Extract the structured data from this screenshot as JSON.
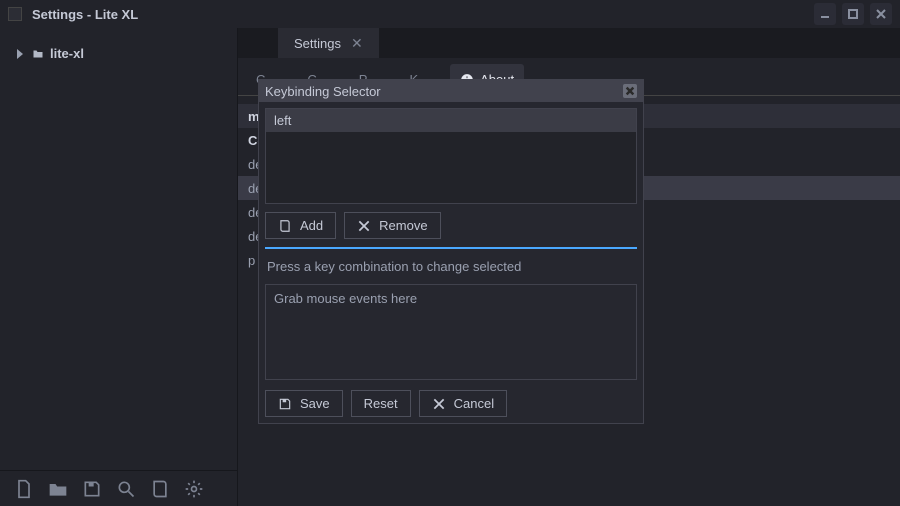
{
  "window": {
    "title": "Settings - Lite XL"
  },
  "tree": {
    "root": "lite-xl"
  },
  "editorTab": {
    "title": "Settings"
  },
  "settingsTabs": {
    "t0": "C",
    "t1": "C",
    "t2": "P",
    "t3": "K",
    "about": "About"
  },
  "bgRows": {
    "r0": "m",
    "r1": "Co",
    "r2": "de",
    "r3": "de",
    "r4": "de",
    "r5": "de",
    "r6": "p"
  },
  "modal": {
    "title": "Keybinding Selector",
    "listItem0": "left",
    "add": "Add",
    "remove": "Remove",
    "hint": "Press a key combination to change selected",
    "placeholder": "Grab mouse events here",
    "save": "Save",
    "reset": "Reset",
    "cancel": "Cancel"
  }
}
